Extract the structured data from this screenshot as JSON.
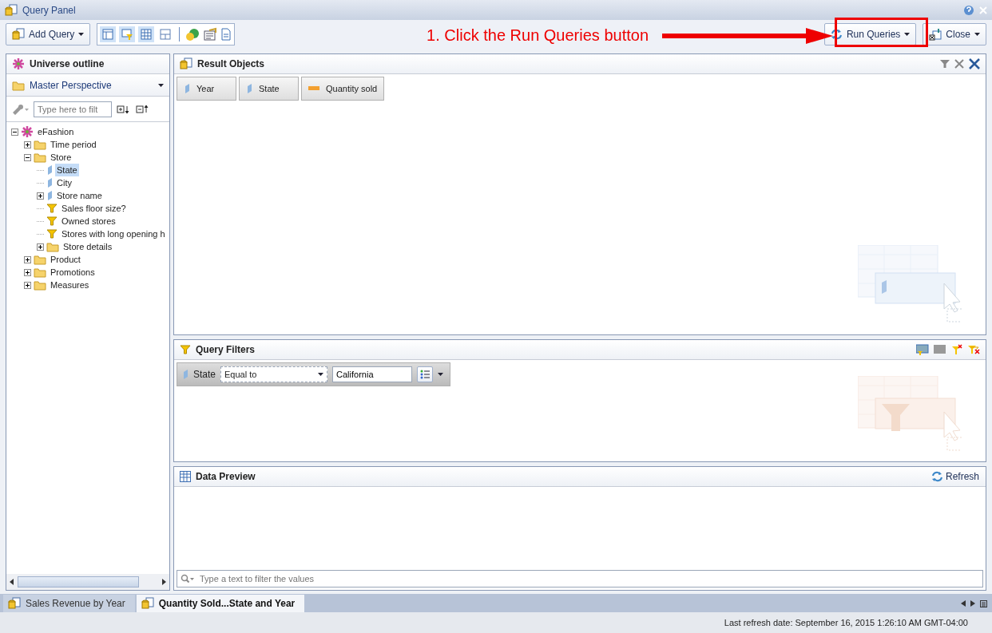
{
  "window": {
    "title": "Query Panel"
  },
  "toolbar": {
    "add_query": "Add Query",
    "view_buttons": [
      {
        "on": true
      },
      {
        "on": true
      },
      {
        "on": true
      },
      {
        "on": false
      }
    ],
    "run_queries": "Run Queries",
    "close": "Close"
  },
  "annotation": {
    "text": "1. Click the Run Queries button"
  },
  "outline": {
    "title": "Universe outline",
    "perspective": "Master Perspective",
    "search": {
      "placeholder": "Type here to filt"
    },
    "tree": [
      {
        "label": "eFashion",
        "kind": "universe",
        "expanded": true,
        "selected": false,
        "children": [
          {
            "label": "Time period",
            "kind": "folder",
            "expanded": false,
            "selected": false
          },
          {
            "label": "Store",
            "kind": "folder",
            "expanded": true,
            "selected": false,
            "children": [
              {
                "label": "State",
                "kind": "dimension",
                "selected": true
              },
              {
                "label": "City",
                "kind": "dimension",
                "selected": false
              },
              {
                "label": "Store name",
                "kind": "dimension",
                "expanded": false,
                "selected": false
              },
              {
                "label": "Sales floor size?",
                "kind": "filter",
                "selected": false
              },
              {
                "label": "Owned stores",
                "kind": "filter",
                "selected": false
              },
              {
                "label": "Stores with long opening h",
                "kind": "filter",
                "selected": false
              },
              {
                "label": "Store details",
                "kind": "folder",
                "expanded": false,
                "selected": false
              }
            ]
          },
          {
            "label": "Product",
            "kind": "folder",
            "expanded": false,
            "selected": false
          },
          {
            "label": "Promotions",
            "kind": "folder",
            "expanded": false,
            "selected": false
          },
          {
            "label": "Measures",
            "kind": "folder",
            "expanded": false,
            "selected": false
          }
        ]
      }
    ]
  },
  "result_objects": {
    "title": "Result Objects",
    "items": [
      {
        "label": "Year",
        "kind": "dimension"
      },
      {
        "label": "State",
        "kind": "dimension"
      },
      {
        "label": "Quantity sold",
        "kind": "measure"
      }
    ]
  },
  "query_filters": {
    "title": "Query Filters",
    "filters": [
      {
        "object": "State",
        "operator": "Equal to",
        "value": "California"
      }
    ]
  },
  "data_preview": {
    "title": "Data Preview",
    "refresh": "Refresh",
    "search": {
      "placeholder": "Type a text to filter the values"
    }
  },
  "query_tabs": [
    {
      "label": "Sales Revenue by Year",
      "selected": false
    },
    {
      "label": "Quantity Sold...State and Year",
      "selected": true
    }
  ],
  "status_bar": {
    "text": "Last refresh date: September 16, 2015 1:26:10 AM GMT-04:00"
  }
}
